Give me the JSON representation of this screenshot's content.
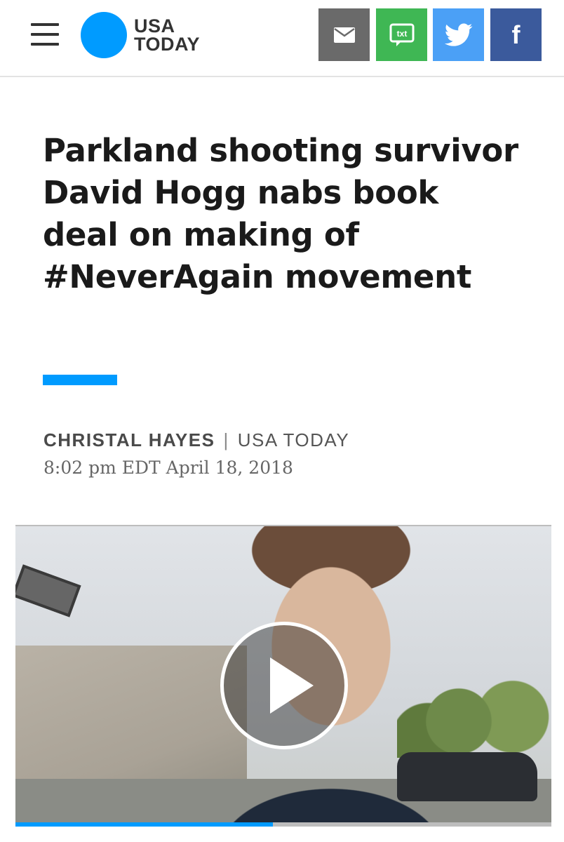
{
  "header": {
    "logo_line1": "USA",
    "logo_line2": "TODAY",
    "share": {
      "email_icon": "email-icon",
      "sms_label": "txt",
      "twitter_icon": "twitter-icon",
      "facebook_label": "f"
    }
  },
  "article": {
    "headline": "Parkland shooting survivor David Hogg nabs book deal on making of #NeverAgain movement",
    "author": "CHRISTAL HAYES",
    "separator": "|",
    "publication": "USA TODAY",
    "timestamp": "8:02 pm EDT April 18, 2018"
  },
  "video": {
    "play_icon": "play-icon",
    "progress": 0.48
  },
  "colors": {
    "brand_blue": "#009bff",
    "email_gray": "#6a6a6a",
    "sms_green": "#3fb754",
    "twitter_blue": "#4ba0f6",
    "facebook_blue": "#3b5a9c"
  }
}
